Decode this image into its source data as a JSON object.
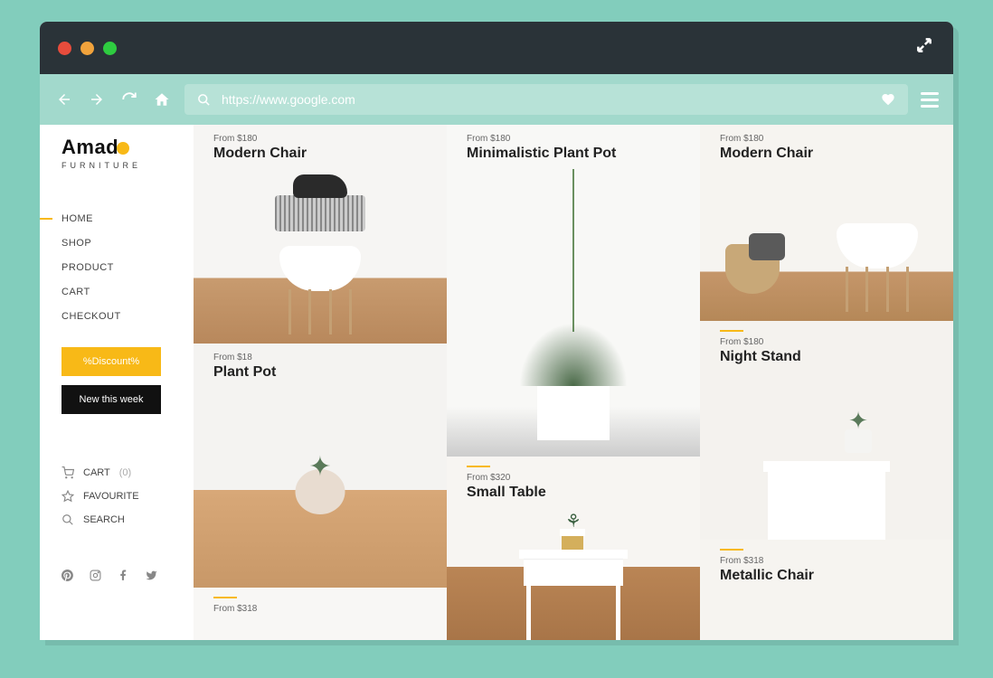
{
  "browser": {
    "url": "https://www.google.com"
  },
  "brand": {
    "name": "Amad",
    "subtitle": "FURNITURE"
  },
  "nav": {
    "items": [
      "HOME",
      "SHOP",
      "PRODUCT",
      "CART",
      "CHECKOUT"
    ]
  },
  "promos": {
    "discount": "%Discount%",
    "new": "New this week"
  },
  "utility": {
    "cart_label": "CART",
    "cart_count": "(0)",
    "favourite": "FAVOURITE",
    "search": "SEARCH"
  },
  "products": {
    "col1": [
      {
        "price": "From $180",
        "title": "Modern Chair"
      },
      {
        "price": "From $18",
        "title": "Plant Pot"
      },
      {
        "price": "From $318",
        "title": ""
      }
    ],
    "col2": [
      {
        "price": "From $180",
        "title": "Minimalistic Plant Pot"
      },
      {
        "price": "From $320",
        "title": "Small Table"
      }
    ],
    "col3": [
      {
        "price": "From $180",
        "title": "Modern Chair"
      },
      {
        "price": "From $180",
        "title": "Night Stand"
      },
      {
        "price": "From $318",
        "title": "Metallic Chair"
      }
    ]
  }
}
